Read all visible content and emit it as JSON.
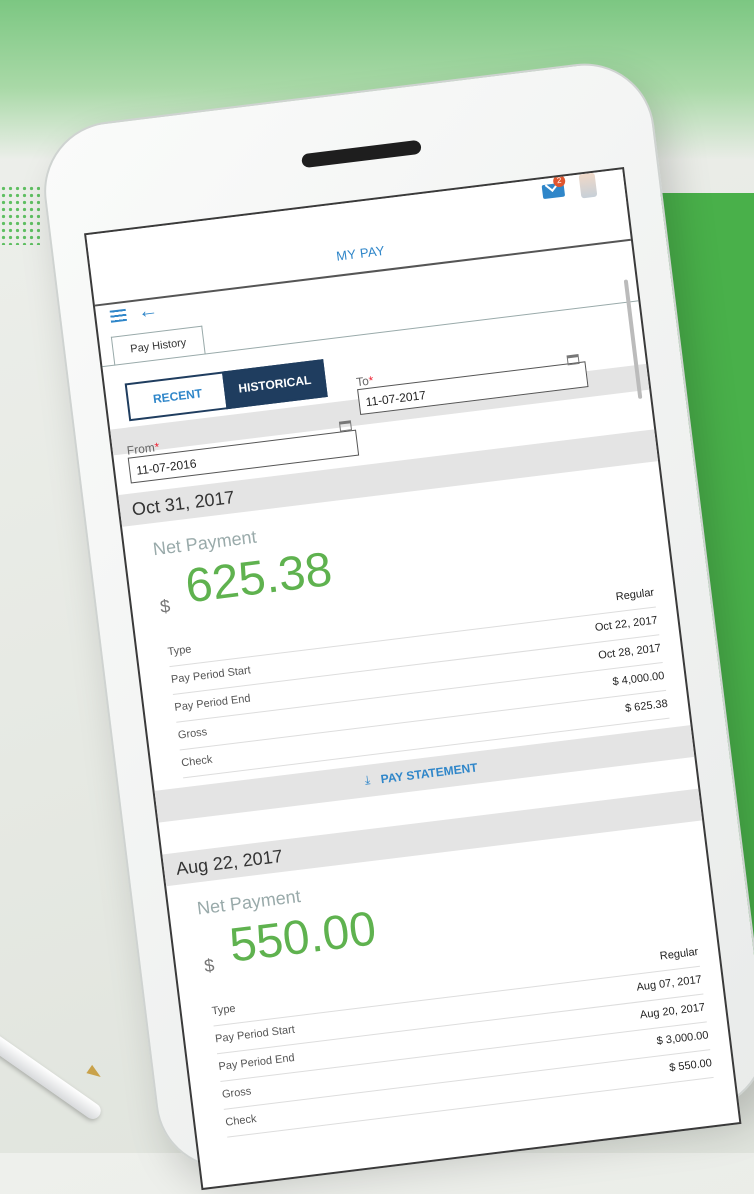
{
  "header": {
    "title": "MY PAY",
    "mail_badge_count": "2"
  },
  "tabs": [
    {
      "label": "Pay History"
    }
  ],
  "toggle": {
    "recent_label": "RECENT",
    "historical_label": "HISTORICAL",
    "selected": "HISTORICAL"
  },
  "filters": {
    "from_label": "From",
    "from_value": "11-07-2016",
    "to_label": "To",
    "to_value": "11-07-2017",
    "required_mark": "*"
  },
  "payments": [
    {
      "date": "Oct 31, 2017",
      "net_label": "Net Payment",
      "currency": "$",
      "amount": "625.38",
      "rows": [
        {
          "label": "Type",
          "value": "Regular"
        },
        {
          "label": "Pay Period Start",
          "value": "Oct 22, 2017"
        },
        {
          "label": "Pay Period End",
          "value": "Oct 28, 2017"
        },
        {
          "label": "Gross",
          "value": "$ 4,000.00"
        },
        {
          "label": "Check",
          "value": "$ 625.38"
        }
      ],
      "statement_label": "PAY STATEMENT"
    },
    {
      "date": "Aug 22, 2017",
      "net_label": "Net Payment",
      "currency": "$",
      "amount": "550.00",
      "rows": [
        {
          "label": "Type",
          "value": "Regular"
        },
        {
          "label": "Pay Period Start",
          "value": "Aug 07, 2017"
        },
        {
          "label": "Pay Period End",
          "value": "Aug 20, 2017"
        },
        {
          "label": "Gross",
          "value": "$ 3,000.00"
        },
        {
          "label": "Check",
          "value": "$ 550.00"
        }
      ]
    }
  ],
  "colors": {
    "accent": "#2f86c9",
    "navy": "#1f3d5f",
    "amount_green": "#5fb24f",
    "brand_green": "#49b04a"
  }
}
